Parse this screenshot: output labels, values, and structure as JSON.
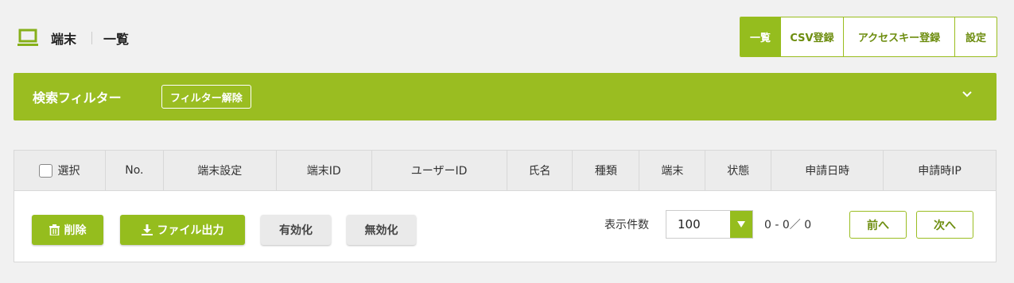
{
  "breadcrumb": {
    "icon": "laptop-icon",
    "section": "端末",
    "page": "一覧"
  },
  "topnav": {
    "tabs": [
      "一覧",
      "CSV登録",
      "アクセスキー登録",
      "設定"
    ],
    "active": 0
  },
  "filter": {
    "title": "検索フィルター",
    "clear_label": "フィルター解除",
    "toggle_icon": "chevron-down-icon"
  },
  "table": {
    "select_label": "選択",
    "columns": [
      "No.",
      "端末設定",
      "端末ID",
      "ユーザーID",
      "氏名",
      "種類",
      "端末",
      "状態",
      "申請日時",
      "申請時IP"
    ]
  },
  "actions": {
    "delete_label": "削除",
    "delete_icon": "trash-icon",
    "export_label": "ファイル出力",
    "export_icon": "download-icon",
    "enable_label": "有効化",
    "disable_label": "無効化"
  },
  "pagination": {
    "per_page_label": "表示件数",
    "per_page_value": "100",
    "range_text": "0 - 0／ 0",
    "prev_label": "前へ",
    "next_label": "次へ"
  },
  "colors": {
    "accent": "#95bd1e",
    "accent_text": "#6d8d0f"
  }
}
